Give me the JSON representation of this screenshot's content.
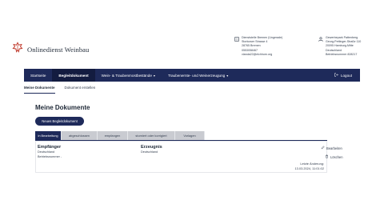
{
  "app": {
    "name": "Onlinedienst Weinbau"
  },
  "office": {
    "lines": [
      "Dienststelle Bremen (Ungerade)",
      "Storkower Strasse 4",
      "28765 Bremen",
      "0553058467",
      "vlanda22@elchhorn.org"
    ]
  },
  "user": {
    "lines": [
      "Gewerbepark Pattenberg",
      "Georg-Pettinger-Straße 110",
      "20095 Hamburg-Mitte",
      "Deutschland",
      "Betriebsnummer 828217"
    ]
  },
  "nav": {
    "items": [
      {
        "label": "Startseite",
        "active": false
      },
      {
        "label": "Begleitdokument",
        "active": true
      },
      {
        "label": "Wein- & Traubenmostbestände",
        "active": false,
        "dropdown": true
      },
      {
        "label": "Traubenernte- und Weinerzeugung",
        "active": false,
        "dropdown": true
      }
    ],
    "logout": "Logout"
  },
  "subnav": {
    "items": [
      "Meine Dokumente",
      "Dokument erstellen"
    ]
  },
  "main": {
    "title": "Meine Dokumente",
    "new_button": "Neues Begleitdokument",
    "tabs": [
      "in Bearbeitung",
      "abgeschlossen",
      "empfangen",
      "storniert oder korrigiert",
      "Vorlagen"
    ],
    "card": {
      "recipient_label": "Empfänger",
      "recipient_country": "Deutschland",
      "recipient_number": "Betriebsnummer -",
      "product_label": "Erzeugnis",
      "product_country": "Deutschland",
      "edit": "Bearbeiten",
      "delete": "Löschen",
      "last_change_label": "Letzte Änderung:",
      "last_change_value": "13.03.2024, 11:01:02"
    }
  },
  "colors": {
    "primary": "#1e2a5a",
    "accent_logo": "#c0392b"
  }
}
